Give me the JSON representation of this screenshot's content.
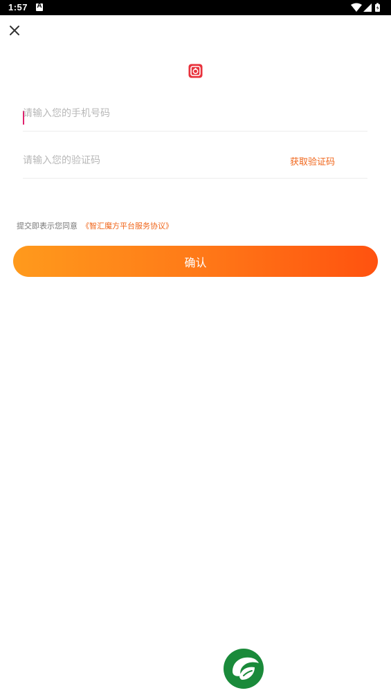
{
  "status_bar": {
    "time": "1:57",
    "notification_icon": "a-icon",
    "wifi_icon": "wifi-icon",
    "signal_icon": "signal-icon",
    "battery_icon": "battery-icon"
  },
  "header": {
    "close_icon": "close-icon"
  },
  "logo": {
    "icon": "app-logo-icon",
    "color": "#e8323c"
  },
  "form": {
    "phone_placeholder": "请输入您的手机号码",
    "phone_value": "",
    "code_placeholder": "请输入您的验证码",
    "code_value": "",
    "get_code_label": "获取验证码"
  },
  "agreement": {
    "text": "提交即表示您同意",
    "link": "《智汇魔方平台服务协议》"
  },
  "confirm_label": "确认",
  "brand": {
    "icon": "leaf-logo-icon",
    "color": "#1a8a3a"
  },
  "colors": {
    "accent": "#f0661b",
    "button_gradient_start": "#ff9a1c",
    "button_gradient_end": "#ff520f",
    "caret": "#e0226e"
  }
}
